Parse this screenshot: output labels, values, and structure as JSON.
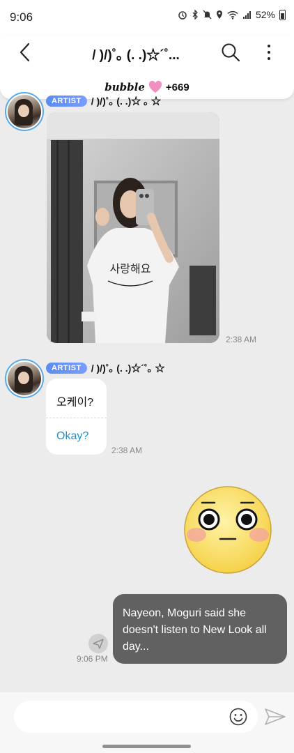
{
  "status_bar": {
    "time": "9:06",
    "battery": "52%"
  },
  "header": {
    "title": "/ )/)˚｡ (. .)☆´˚...",
    "bubble_brand": "bubble",
    "bubble_count": "+669"
  },
  "messages": [
    {
      "sender_badge": "ARTIST",
      "sender_name": "/ )/)˚｡ (. .)☆ ｡ ☆",
      "type": "photo",
      "photo_print": "사랑해요",
      "time": "2:38 AM"
    },
    {
      "sender_badge": "ARTIST",
      "sender_name": "/ )/)˚｡ (. .)☆´˚｡ ☆",
      "type": "text",
      "text_original": "오케이?",
      "text_translated": "Okay?",
      "time": "2:38 AM"
    },
    {
      "sender": "me",
      "type": "emoji",
      "emoji_icon": "flushed-face-emoji"
    },
    {
      "sender": "me",
      "type": "text",
      "text": "Nayeon, Moguri said she doesn't listen to New Look all day...",
      "time": "9:06 PM"
    }
  ],
  "composer": {
    "input_value": "",
    "emoji_icon": "smiley-icon",
    "send_icon": "send-icon"
  },
  "colors": {
    "chat_background": "#ececec",
    "my_bubble": "#616161",
    "translation_text": "#1a93c9",
    "artist_badge": "#5a8df0",
    "avatar_ring": "#5aa8e6"
  }
}
